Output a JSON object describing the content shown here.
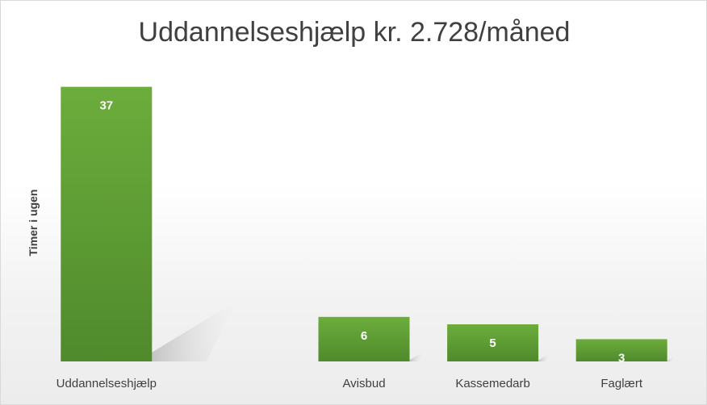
{
  "chart_data": {
    "type": "bar",
    "title": "Uddannelseshjælp kr. 2.728/måned",
    "xlabel": "",
    "ylabel": "Timer i ugen",
    "categories": [
      "Uddannelseshjælp",
      "",
      "Avisbud",
      "Kassemedarb",
      "Faglært"
    ],
    "values": [
      37,
      null,
      6,
      5,
      3
    ],
    "data_labels": [
      "37",
      "",
      "6",
      "5",
      "3"
    ],
    "ylim": [
      0,
      40
    ],
    "grid": false,
    "legend": "none",
    "bar_color": "#5f9e33"
  }
}
